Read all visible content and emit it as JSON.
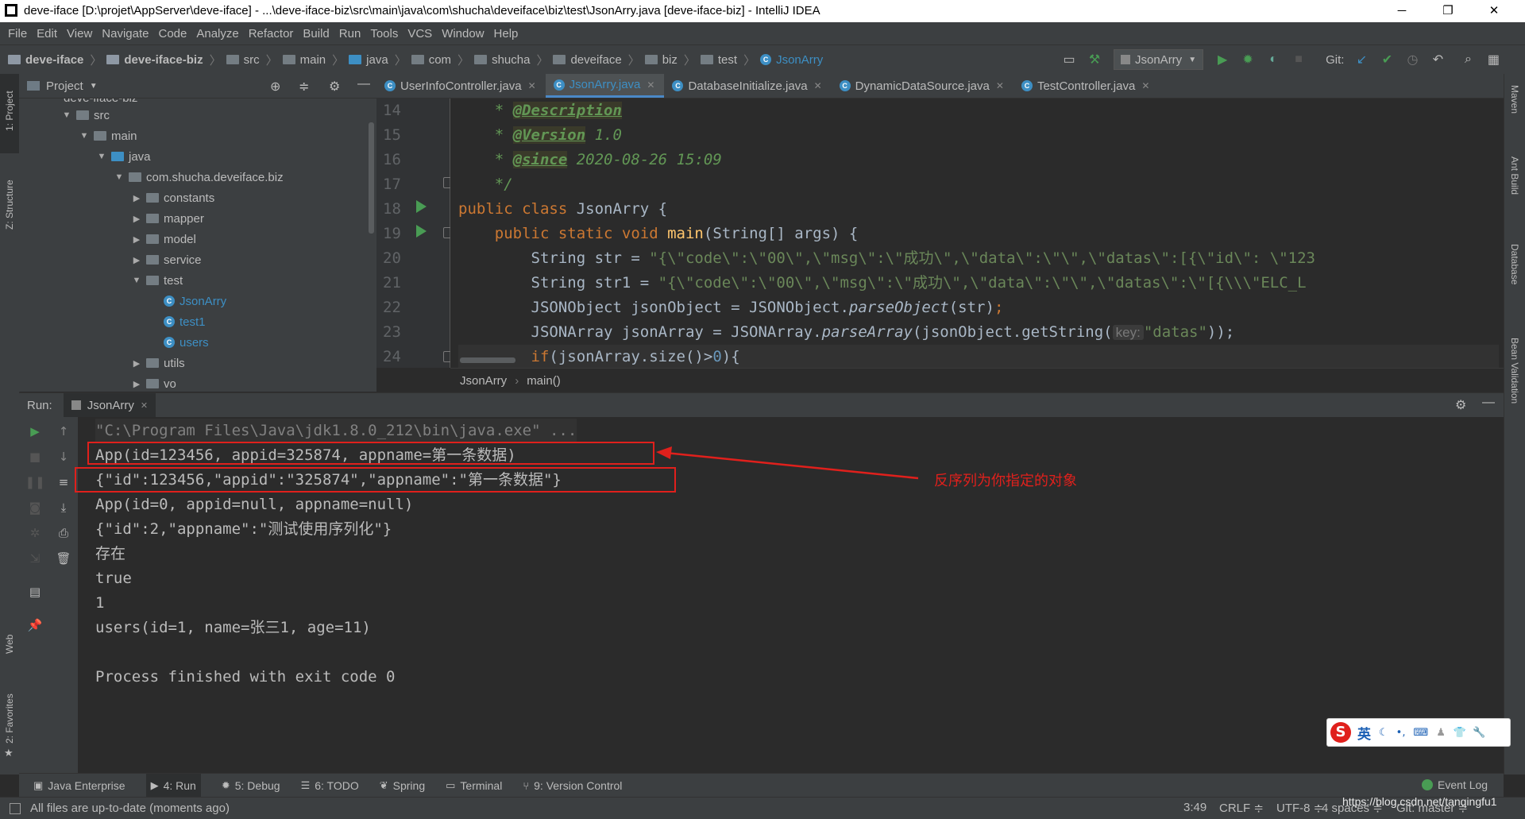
{
  "window": {
    "title": "deve-iface [D:\\projet\\AppServer\\deve-iface] - ...\\deve-iface-biz\\src\\main\\java\\com\\shucha\\deveiface\\biz\\test\\JsonArry.java [deve-iface-biz] - IntelliJ IDEA",
    "minimize": "─",
    "restore": "❐",
    "close": "✕"
  },
  "menu": [
    "File",
    "Edit",
    "View",
    "Navigate",
    "Code",
    "Analyze",
    "Refactor",
    "Build",
    "Run",
    "Tools",
    "VCS",
    "Window",
    "Help"
  ],
  "nav": {
    "crumbs": [
      "deve-iface",
      "deve-iface-biz",
      "src",
      "main",
      "java",
      "com",
      "shucha",
      "deveiface",
      "biz",
      "test"
    ],
    "file": "JsonArry",
    "run_config": "JsonArry",
    "git_label": "Git:"
  },
  "project": {
    "header": "Project",
    "cut_item": "deve-iface-biz",
    "tree": [
      {
        "label": "src"
      },
      {
        "label": "main"
      },
      {
        "label": "java"
      },
      {
        "label": "com.shucha.deveiface.biz"
      },
      {
        "label": "constants"
      },
      {
        "label": "mapper"
      },
      {
        "label": "model"
      },
      {
        "label": "service"
      },
      {
        "label": "test"
      },
      {
        "label": "JsonArry"
      },
      {
        "label": "test1"
      },
      {
        "label": "users"
      },
      {
        "label": "utils"
      },
      {
        "label": "vo"
      }
    ]
  },
  "tabs": [
    {
      "label": "UserInfoController.java"
    },
    {
      "label": "JsonArry.java"
    },
    {
      "label": "DatabaseInitialize.java"
    },
    {
      "label": "DynamicDataSource.java"
    },
    {
      "label": "TestController.java"
    }
  ],
  "editor": {
    "line_numbers": [
      "14",
      "15",
      "16",
      "17",
      "18",
      "19",
      "20",
      "21",
      "22",
      "23",
      "24"
    ],
    "l14": {
      "star": "* ",
      "tag": "@Description"
    },
    "l15": {
      "star": "* ",
      "tag": "@Version",
      "rest": " 1.0"
    },
    "l16": {
      "star": "* ",
      "tag": "@since",
      "rest": " 2020-08-26 15:09"
    },
    "l17": {
      "end": "*/"
    },
    "l18": {
      "kw": "public class ",
      "name": "JsonArry {"
    },
    "l19": {
      "kw": "public static void ",
      "name": "main",
      "rest": "(String[] args) {"
    },
    "l20": {
      "pre": "String str = ",
      "str": "\"{\\\"code\\\":\\\"00\\\",\\\"msg\\\":\\\"成功\\\",\\\"data\\\":\\\"\\\",\\\"datas\\\":[{\\\"id\\\": \\\"123"
    },
    "l21": {
      "pre": "String str1 = ",
      "str": "\"{\\\"code\\\":\\\"00\\\",\\\"msg\\\":\\\"成功\\\",\\\"data\\\":\\\"\\\",\\\"datas\\\":\\\"[{\\\\\\\"ELC_L"
    },
    "l22": {
      "pre": "JSONObject jsonObject = JSONObject.",
      "method": "parseObject",
      "rest": "(str)",
      "semi": ";"
    },
    "l23": {
      "pre": "JSONArray jsonArray = JSONArray.",
      "method": "parseArray",
      "rest": "(jsonObject.getString(",
      "hint": "key:",
      "str": "\"datas\"",
      "end": "));"
    },
    "l24": {
      "kw": "if",
      "rest": "(jsonArray.size()>",
      "num": "0",
      "end": "){"
    },
    "breadcrumb": [
      "JsonArry",
      "main()"
    ]
  },
  "run": {
    "label": "Run:",
    "tab": "JsonArry",
    "output": [
      "\"C:\\Program Files\\Java\\jdk1.8.0_212\\bin\\java.exe\" ...",
      "App(id=123456, appid=325874, appname=第一条数据)",
      "{\"id\":123456,\"appid\":\"325874\",\"appname\":\"第一条数据\"}",
      "App(id=0, appid=null, appname=null)",
      "{\"id\":2,\"appname\":\"测试使用序列化\"}",
      "存在",
      "true",
      "1",
      "users(id=1, name=张三1, age=11)",
      "",
      "Process finished with exit code 0"
    ],
    "annotation": "反序列为你指定的对象"
  },
  "left_strip": [
    "1: Project",
    "Z: Structure",
    "Web",
    "2: Favorites"
  ],
  "right_strip": [
    "Maven",
    "Ant Build",
    "Database",
    "Bean Validation"
  ],
  "bottom_tabs": [
    {
      "label": "Java Enterprise"
    },
    {
      "label": "4: Run"
    },
    {
      "label": "5: Debug"
    },
    {
      "label": "6: TODO"
    },
    {
      "label": "Spring"
    },
    {
      "label": "Terminal"
    },
    {
      "label": "9: Version Control"
    }
  ],
  "event_log": "Event Log",
  "status": {
    "message": "All files are up-to-date (moments ago)",
    "position": "3:49",
    "line_sep": "CRLF ≑",
    "encoding": "UTF-8 ≑",
    "indent": "4 spaces ≑",
    "branch": "Git: master ≑",
    "watermark": "https://blog.csdn.net/tanqingfu1"
  },
  "ime": {
    "lang": "英",
    "logo": "S"
  },
  "colors": {
    "accent": "#3d8fc4",
    "run_green": "#499c54",
    "annotation_red": "#e0201c",
    "keyword": "#cc7832",
    "string": "#6a8759",
    "comment": "#629755"
  }
}
